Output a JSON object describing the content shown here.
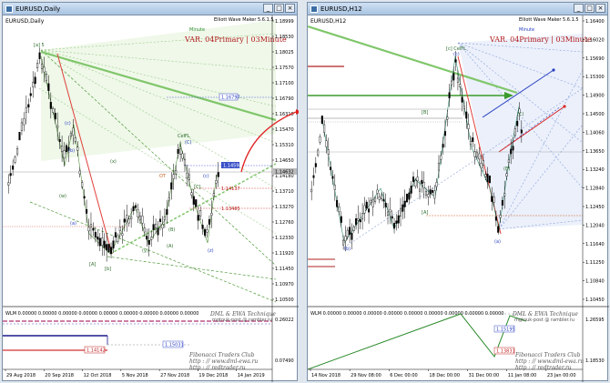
{
  "left": {
    "title": "EURUSD,Daily",
    "symbol": "EURUSD,Daily",
    "indicator": "Elliott Wave Maker 5.6.1.5",
    "timeframe_tag": "Minute",
    "header": "VAR. 04Primary | 03Minute",
    "price_ticks": [
      "1.18999",
      "1.18530",
      "1.18025",
      "1.17570",
      "1.17100",
      "1.16790",
      "1.16310",
      "1.15470",
      "1.15310",
      "1.14650",
      "1.14180",
      "1.13710",
      "1.13270",
      "1.12760",
      "1.12330",
      "1.11920",
      "1.11450",
      "1.10970",
      "1.10500"
    ],
    "price_labels": {
      "blue1": "1.16797",
      "blue2": "1.14594",
      "red1": "1.14137",
      "red2": "1.13485",
      "current": "1.14632"
    },
    "wlm_text": "WLM 0.00000 0.00000 0.00000 0.00000 0.00000 0.00000 0.00000 0.00000 0.00000",
    "osc_ticks": [
      "0.26022",
      "0.07490"
    ],
    "osc_labels": {
      "blue": "1.15031",
      "red": "1.14142"
    },
    "brand_top": "DML & EWA Technique",
    "brand_email": "mgtouk-post @ rambler.ru",
    "brand_bottom1": "Fibonacci  Traders  Club",
    "brand_bottom2": "http : // www.dml-ewa.ru",
    "brand_bottom3": "http : // redtrader.ru",
    "date_ticks": [
      "29 Aug 2018",
      "20 Sep 2018",
      "12 Oct 2018",
      "5 Nov 2018",
      "27 Nov 2018",
      "19 Dec 2018",
      "14 Jan 2019"
    ],
    "waves": [
      "[a] 5",
      "(c)",
      "(a)",
      "(b)",
      "(w)",
      "(x)",
      "[b]",
      "(y)",
      "(z)",
      "[A]",
      "(B)",
      "CelFL",
      "(C)",
      "OT",
      "[C]",
      "(A)",
      "(c)"
    ]
  },
  "right": {
    "title": "EURUSD,H12",
    "symbol": "EURUSD,H12",
    "indicator": "Elliott Wave Maker 5.6.1.5",
    "timeframe_tag": "Minute",
    "header": "VAR. 04Primary | 03Minute",
    "price_ticks": [
      "1.16400",
      "1.16020",
      "1.15690",
      "1.15300",
      "1.14900",
      "1.14500",
      "1.14060",
      "1.13650",
      "1.13240",
      "1.12840",
      "1.12450",
      "1.12040",
      "1.11640",
      "1.11250",
      "1.10840",
      "1.10450"
    ],
    "wlm_text": "WLM 0.00000 0.00000 0.00000 0.00000 0.00000 0.00000 0.00000 0.00000 0.00000",
    "osc_ticks": [
      "1.26595",
      "1.18530"
    ],
    "osc_labels": {
      "blue": "1.15195",
      "red": "1.13831"
    },
    "brand_top": "DML & EWA Technique",
    "brand_email": "mgtouk-post @ rambler.ru",
    "brand_bottom1": "Fibonacci  Traders  Club",
    "brand_bottom2": "http : // www.dml-ewa.ru",
    "brand_bottom3": "http : // redtrader.ru",
    "date_ticks": [
      "14 Nov 2018",
      "29 Nov 08:00",
      "6 Dec 00:00",
      "18 Dec 00:00",
      "31 Dec 00:00",
      "11 Jan 08:00",
      "23 Jan 00:00"
    ],
    "waves": [
      "[c] CelFL",
      "(c)",
      "(a)",
      "(b)",
      "[B]",
      "[A]",
      "(B)",
      "(C)"
    ]
  }
}
